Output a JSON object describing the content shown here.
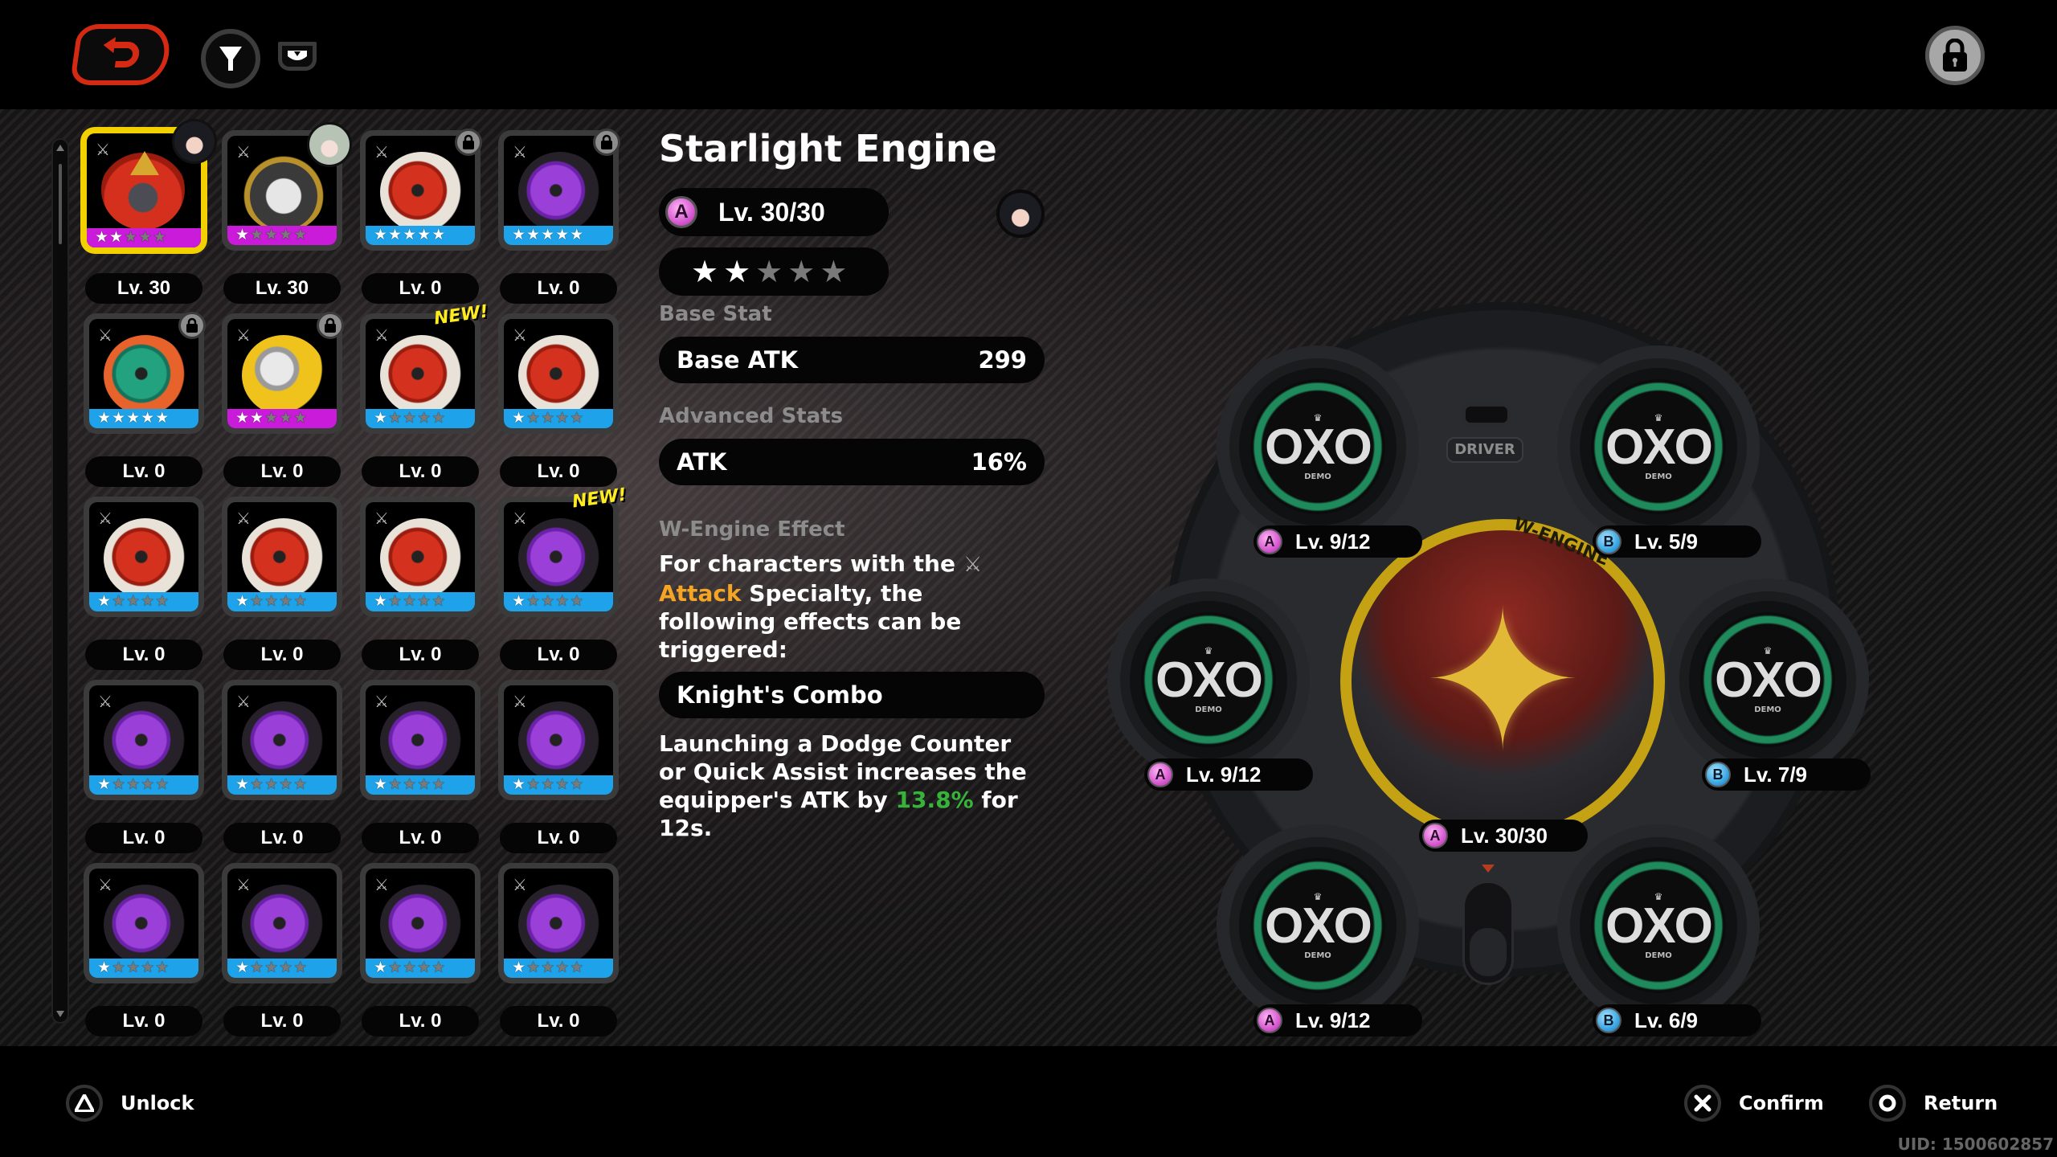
{
  "topbar": {
    "back_icon": "back-arrow-icon",
    "filter_icon": "filter-funnel-icon",
    "sort_icon": "sort-dropdown-icon",
    "lock_icon": "lock-icon"
  },
  "colors": {
    "accent_red": "#d42a13",
    "selected_yellow": "#f3d000",
    "rarity_A": "#c91bd9",
    "rarity_B": "#1ea3ea",
    "highlight_orange": "#f5a524",
    "highlight_green": "#36b43a",
    "disc_green": "#1f8a5c",
    "engine_gold": "#c5a114"
  },
  "inventory": {
    "items": [
      {
        "level": "Lv. 30",
        "rarity": "A",
        "stars": 2,
        "art": "red-helmet",
        "selected": true,
        "badge": "avatar-dark"
      },
      {
        "level": "Lv. 30",
        "rarity": "A",
        "stars": 1,
        "art": "gray-bomb",
        "selected": false,
        "badge": "avatar-light"
      },
      {
        "level": "Lv. 0",
        "rarity": "B",
        "stars": 5,
        "art": "red-disc",
        "selected": false,
        "badge": "lock"
      },
      {
        "level": "Lv. 0",
        "rarity": "B",
        "stars": 5,
        "art": "purple-disc",
        "selected": false,
        "badge": "lock"
      },
      {
        "level": "Lv. 0",
        "rarity": "B",
        "stars": 5,
        "art": "green-disc",
        "selected": false,
        "badge": "lock"
      },
      {
        "level": "Lv. 0",
        "rarity": "A",
        "stars": 2,
        "art": "yellow-ball",
        "selected": false,
        "badge": "lock"
      },
      {
        "level": "Lv. 0",
        "rarity": "B",
        "stars": 1,
        "art": "red-disc",
        "selected": false,
        "badge": "new"
      },
      {
        "level": "Lv. 0",
        "rarity": "B",
        "stars": 1,
        "art": "red-disc",
        "selected": false,
        "badge": ""
      },
      {
        "level": "Lv. 0",
        "rarity": "B",
        "stars": 1,
        "art": "red-disc",
        "selected": false,
        "badge": ""
      },
      {
        "level": "Lv. 0",
        "rarity": "B",
        "stars": 1,
        "art": "red-disc",
        "selected": false,
        "badge": ""
      },
      {
        "level": "Lv. 0",
        "rarity": "B",
        "stars": 1,
        "art": "red-disc",
        "selected": false,
        "badge": ""
      },
      {
        "level": "Lv. 0",
        "rarity": "B",
        "stars": 1,
        "art": "purple-disc",
        "selected": false,
        "badge": "new"
      },
      {
        "level": "Lv. 0",
        "rarity": "B",
        "stars": 1,
        "art": "purple-disc",
        "selected": false,
        "badge": ""
      },
      {
        "level": "Lv. 0",
        "rarity": "B",
        "stars": 1,
        "art": "purple-disc",
        "selected": false,
        "badge": ""
      },
      {
        "level": "Lv. 0",
        "rarity": "B",
        "stars": 1,
        "art": "purple-disc",
        "selected": false,
        "badge": ""
      },
      {
        "level": "Lv. 0",
        "rarity": "B",
        "stars": 1,
        "art": "purple-disc",
        "selected": false,
        "badge": ""
      },
      {
        "level": "Lv. 0",
        "rarity": "B",
        "stars": 1,
        "art": "purple-disc",
        "selected": false,
        "badge": ""
      },
      {
        "level": "Lv. 0",
        "rarity": "B",
        "stars": 1,
        "art": "purple-disc",
        "selected": false,
        "badge": ""
      },
      {
        "level": "Lv. 0",
        "rarity": "B",
        "stars": 1,
        "art": "purple-disc",
        "selected": false,
        "badge": ""
      },
      {
        "level": "Lv. 0",
        "rarity": "B",
        "stars": 1,
        "art": "purple-disc",
        "selected": false,
        "badge": ""
      }
    ],
    "new_label": "NEW!"
  },
  "detail": {
    "title": "Starlight Engine",
    "rank": "A",
    "level": "Lv. 30/30",
    "stars_filled": 2,
    "stars_total": 5,
    "base_stat_label": "Base Stat",
    "base_stat": {
      "name": "Base ATK",
      "value": "299"
    },
    "advanced_stats_label": "Advanced Stats",
    "advanced_stat": {
      "name": "ATK",
      "value": "16%"
    },
    "effect_label": "W-Engine Effect",
    "effect_intro_1": "For characters with the",
    "effect_intro_specialty": "Attack",
    "effect_intro_2": " Specialty, the following effects can be triggered:",
    "skill_name": "Knight's Combo",
    "skill_desc_1": "Launching a Dodge Counter or Quick Assist increases the equipper's ATK by ",
    "skill_desc_value": "13.8%",
    "skill_desc_2": " for 12s."
  },
  "equipment": {
    "driver_label": "DRIVER",
    "engine_ring_text": "W-ENGINE",
    "engine": {
      "rank": "A",
      "level": "Lv. 30/30"
    },
    "discs": [
      {
        "slot": "top-left",
        "rank": "A",
        "level": "Lv. 9/12",
        "logo": "OXO",
        "sub": "DEMO"
      },
      {
        "slot": "top-right",
        "rank": "B",
        "level": "Lv. 5/9",
        "logo": "OXO",
        "sub": "DEMO"
      },
      {
        "slot": "mid-left",
        "rank": "A",
        "level": "Lv. 9/12",
        "logo": "OXO",
        "sub": "DEMO"
      },
      {
        "slot": "mid-right",
        "rank": "B",
        "level": "Lv. 7/9",
        "logo": "OXO",
        "sub": "DEMO"
      },
      {
        "slot": "bottom-left",
        "rank": "A",
        "level": "Lv. 9/12",
        "logo": "OXO",
        "sub": "DEMO"
      },
      {
        "slot": "bottom-right",
        "rank": "B",
        "level": "Lv. 6/9",
        "logo": "OXO",
        "sub": "DEMO"
      }
    ]
  },
  "bottombar": {
    "unlock_label": "Unlock",
    "confirm_label": "Confirm",
    "return_label": "Return",
    "uid": "UID: 1500602857"
  }
}
